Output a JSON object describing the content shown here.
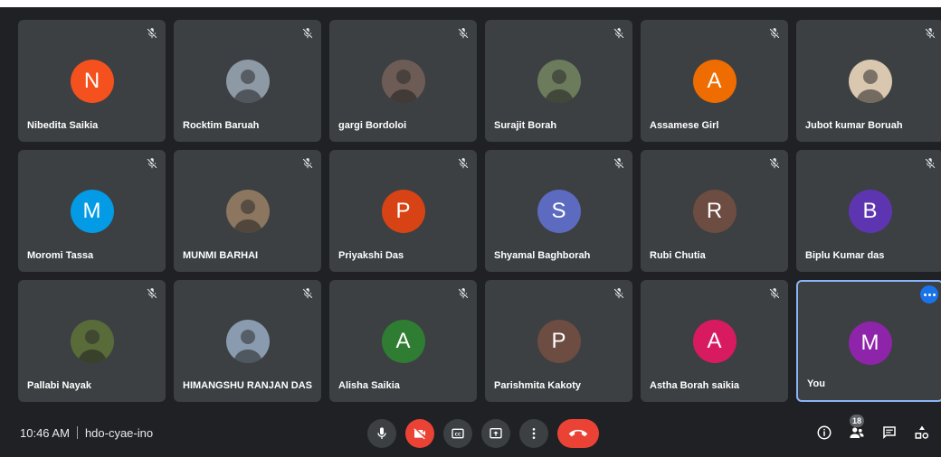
{
  "meeting": {
    "time": "10:46 AM",
    "code": "hdo-cyae-ino"
  },
  "participants_count": "18",
  "colors": {
    "tile": "#3c4043",
    "background": "#202124",
    "self_border": "#8ab4f8",
    "danger": "#ea4335"
  },
  "tiles": [
    {
      "name": "Nibedita Saikia",
      "initial": "N",
      "color": "#f4511e",
      "muted": true
    },
    {
      "name": "Rocktim Baruah",
      "initial": "",
      "color": "#8d9aa6",
      "muted": true,
      "photo": true
    },
    {
      "name": "gargi Bordoloi",
      "initial": "",
      "color": "#6d5c55",
      "muted": true,
      "photo": true
    },
    {
      "name": "Surajit Borah",
      "initial": "",
      "color": "#6b7b5c",
      "muted": true,
      "photo": true
    },
    {
      "name": "Assamese Girl",
      "initial": "A",
      "color": "#ef6c00",
      "muted": true
    },
    {
      "name": "Jubot kumar Boruah",
      "initial": "",
      "color": "#d9c7b0",
      "muted": true,
      "photo": true
    },
    {
      "name": "Moromi Tassa",
      "initial": "M",
      "color": "#039be5",
      "muted": true
    },
    {
      "name": "MUNMI BARHAI",
      "initial": "",
      "color": "#8c7660",
      "muted": true,
      "photo": true
    },
    {
      "name": "Priyakshi Das",
      "initial": "P",
      "color": "#d84315",
      "muted": true
    },
    {
      "name": "Shyamal Baghborah",
      "initial": "S",
      "color": "#5c6bc0",
      "muted": true
    },
    {
      "name": "Rubi Chutia",
      "initial": "R",
      "color": "#6d4c41",
      "muted": true
    },
    {
      "name": "Biplu Kumar das",
      "initial": "B",
      "color": "#5e35b1",
      "muted": true
    },
    {
      "name": "Pallabi Nayak",
      "initial": "",
      "color": "#5a6b3a",
      "muted": true,
      "photo": true
    },
    {
      "name": "HIMANGSHU RANJAN DAS",
      "initial": "",
      "color": "#8a9bb0",
      "muted": true,
      "photo": true
    },
    {
      "name": "Alisha Saikia",
      "initial": "A",
      "color": "#2e7d32",
      "muted": true
    },
    {
      "name": "Parishmita Kakoty",
      "initial": "P",
      "color": "#6d4c41",
      "muted": true
    },
    {
      "name": "Astha Borah saikia",
      "initial": "A",
      "color": "#d81b60",
      "muted": true
    },
    {
      "name": "You",
      "initial": "M",
      "color": "#8e24aa",
      "muted": false,
      "self": true
    }
  ],
  "controls": [
    {
      "id": "mic",
      "icon": "microphone-icon"
    },
    {
      "id": "camera",
      "icon": "camera-off-icon"
    },
    {
      "id": "captions",
      "icon": "captions-icon"
    },
    {
      "id": "present",
      "icon": "present-screen-icon"
    },
    {
      "id": "more",
      "icon": "more-vert-icon"
    },
    {
      "id": "leave",
      "icon": "hang-up-icon"
    }
  ],
  "right_icons": [
    "info-icon",
    "people-icon",
    "chat-icon",
    "activities-icon"
  ]
}
